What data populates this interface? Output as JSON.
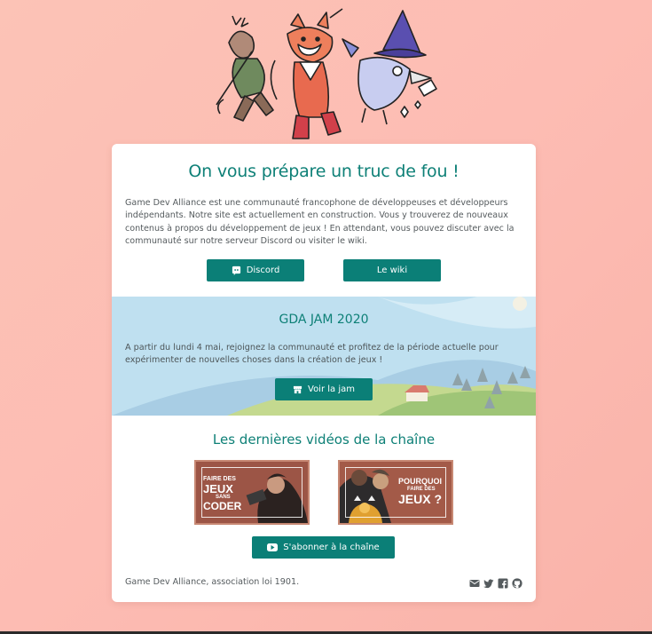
{
  "hero": {
    "title": "On vous prépare un truc de fou !",
    "intro": "Game Dev Alliance est une communauté francophone de développeuses et développeurs indépendants. Notre site est actuellement en construction. Vous y trouverez de nouveaux contenus à propos du développement de jeux ! En attendant, vous pouvez discuter avec la communauté sur notre serveur Discord ou visiter le wiki.",
    "discord_label": "Discord",
    "wiki_label": "Le wiki"
  },
  "jam": {
    "title": "GDA JAM 2020",
    "text": "A partir du lundi 4 mai, rejoignez la communauté et profitez de la période actuelle pour expérimenter de nouvelles choses dans la création de jeux !",
    "button_label": "Voir la jam"
  },
  "videos": {
    "title": "Les dernières vidéos de la chaîne",
    "items": [
      {
        "line1": "FAIRE DES",
        "line2": "JEUX",
        "line3": "SANS",
        "line4": "CODER"
      },
      {
        "line1": "POURQUOI",
        "line2": "FAIRE DES",
        "line3": "JEUX ?"
      }
    ],
    "subscribe_label": "S'abonner à la chaîne"
  },
  "footer": {
    "text": "Game Dev Alliance, association loi 1901.",
    "icons": [
      "mail-icon",
      "twitter-icon",
      "facebook-icon",
      "github-icon"
    ]
  },
  "colors": {
    "accent": "#0b7f77",
    "title": "#0e8077",
    "background": "#fcc3b6",
    "jam_sky": "#bfe0f0"
  }
}
